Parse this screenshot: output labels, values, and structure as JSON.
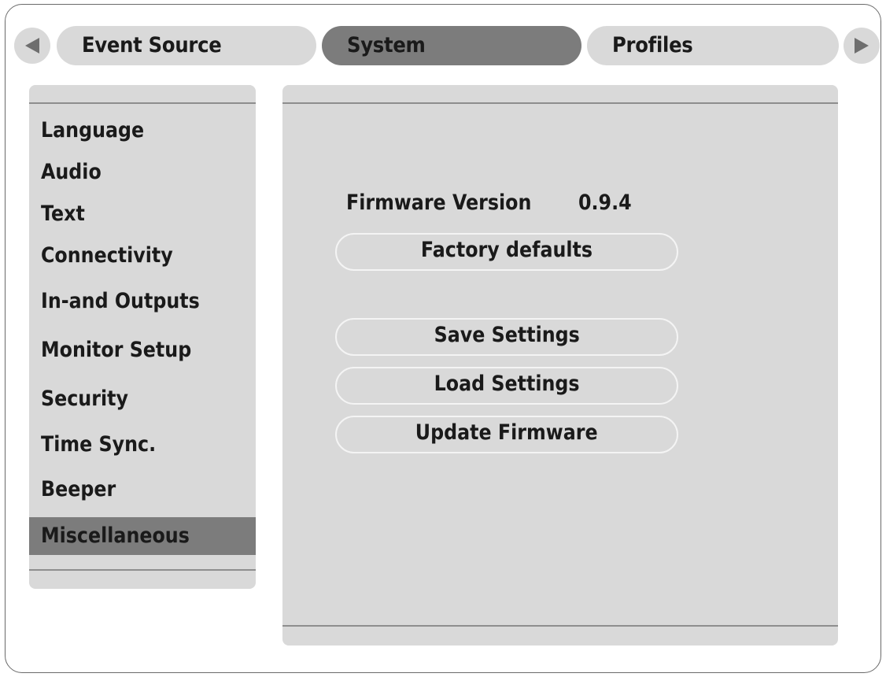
{
  "tabs": [
    {
      "label": "Event Source",
      "active": false
    },
    {
      "label": "System",
      "active": true
    },
    {
      "label": "Profiles",
      "active": false
    }
  ],
  "nav": {
    "prev_icon": "arrow-left-icon",
    "next_icon": "arrow-right-icon"
  },
  "sidebar": {
    "items": [
      {
        "label": "Language"
      },
      {
        "label": "Audio"
      },
      {
        "label": "Text"
      },
      {
        "label": "Connectivity"
      },
      {
        "label": "In-and Outputs"
      },
      {
        "label": "Monitor Setup"
      },
      {
        "label": "Security"
      },
      {
        "label": "Time Sync."
      },
      {
        "label": "Beeper"
      },
      {
        "label": "Miscellaneous"
      }
    ],
    "selected": "Miscellaneous"
  },
  "main": {
    "firmware_label": "Firmware Version",
    "firmware_value": "0.9.4",
    "buttons": {
      "factory_defaults": "Factory defaults",
      "save_settings": "Save Settings",
      "load_settings": "Load Settings",
      "update_firmware": "Update Firmware"
    }
  },
  "colors": {
    "background": "#ffffff",
    "panel": "#d9d9d9",
    "selected": "#7c7c7c",
    "rule": "#8e8e8e",
    "button_border": "#f4f4f4"
  }
}
